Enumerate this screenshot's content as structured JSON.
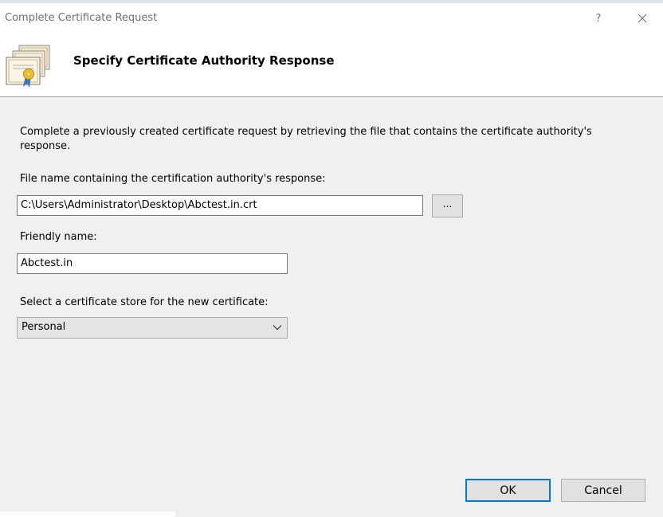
{
  "window": {
    "title": "Complete Certificate Request",
    "help_label": "?",
    "close_label": "✕"
  },
  "header": {
    "title": "Specify Certificate Authority Response",
    "icon": "certificate-icon"
  },
  "form": {
    "description": "Complete a previously created certificate request by retrieving the file that contains the certificate authority's response.",
    "file_label": "File name containing the certification authority's response:",
    "file_value": "C:\\Users\\Administrator\\Desktop\\Abctest.in.crt",
    "browse_label": "...",
    "friendly_label": "Friendly name:",
    "friendly_value": "Abctest.in",
    "store_label": "Select a certificate store for the new certificate:",
    "store_value": "Personal"
  },
  "buttons": {
    "ok": "OK",
    "cancel": "Cancel"
  },
  "colors": {
    "accent": "#0078d7",
    "dialog_bg": "#f0f0f0"
  }
}
